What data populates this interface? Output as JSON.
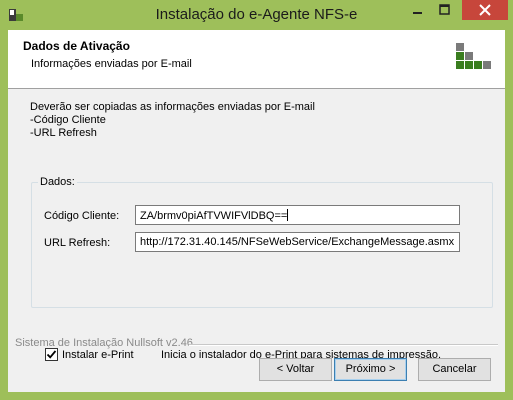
{
  "window": {
    "title": "Instalação do e-Agente NFS-e"
  },
  "header": {
    "title": "Dados de Ativação",
    "subtitle": "Informações enviadas por E-mail"
  },
  "intro": {
    "line1": "Deverão ser copiadas as informações enviadas por E-mail",
    "line2": "-Código Cliente",
    "line3": "-URL Refresh"
  },
  "group": {
    "label": "Dados:",
    "codigo_label": "Código Cliente:",
    "codigo_value": "ZA/brmv0piAfTVWIFVlDBQ==",
    "url_label": "URL Refresh:",
    "url_value": "http://172.31.40.145/NFSeWebService/ExchangeMessage.asmx",
    "eprint_label": "Instalar e-Print",
    "eprint_checked": true,
    "eprint_desc": "Inicia o instalador do e-Print para sistemas de impressão."
  },
  "footer": {
    "branding": "Sistema de Instalação Nullsoft v2.46",
    "back_label": "< Voltar",
    "next_label": "Próximo >",
    "cancel_label": "Cancelar"
  },
  "colors": {
    "frame": "#9ebf5a",
    "close": "#c7463b",
    "logo_green": "#3a7d1f",
    "logo_gray": "#7a7a7a"
  }
}
